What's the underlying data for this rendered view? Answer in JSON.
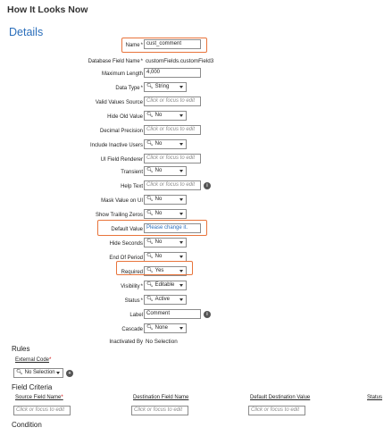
{
  "page": {
    "heading": "How It Looks Now",
    "section_title": "Details"
  },
  "fields": [
    {
      "id": "name",
      "label": "Name",
      "req": "*",
      "type": "text",
      "value": "cust_comment",
      "style": "val"
    },
    {
      "id": "db-field-name",
      "label": "Database Field Name",
      "req": "*",
      "type": "plain",
      "value": "customFields.customField3"
    },
    {
      "id": "max-length",
      "label": "Maximum Length",
      "req": "",
      "type": "text",
      "value": "4,000",
      "style": "val"
    },
    {
      "id": "data-type",
      "label": "Data Type",
      "req": "*",
      "type": "select",
      "value": "String"
    },
    {
      "id": "valid-values-source",
      "label": "Valid Values Source",
      "req": "",
      "type": "text",
      "value": "Click or focus to edit",
      "style": "ph"
    },
    {
      "id": "hide-old-value",
      "label": "Hide Old Value",
      "req": "",
      "type": "select",
      "value": "No"
    },
    {
      "id": "decimal-precision",
      "label": "Decimal Precision",
      "req": "",
      "type": "text",
      "value": "Click or focus to edit",
      "style": "ph"
    },
    {
      "id": "include-inactive-users",
      "label": "Include Inactive Users",
      "req": "",
      "type": "select",
      "value": "No"
    },
    {
      "id": "ui-field-renderer",
      "label": "UI Field Renderer",
      "req": "",
      "type": "text",
      "value": "Click or focus to edit",
      "style": "ph"
    },
    {
      "id": "transient",
      "label": "Transient",
      "req": "",
      "type": "select",
      "value": "No"
    },
    {
      "id": "help-text",
      "label": "Help Text",
      "req": "",
      "type": "text",
      "value": "Click or focus to edit",
      "style": "ph",
      "info": true
    },
    {
      "id": "mask-value-on-ui",
      "label": "Mask Value on UI",
      "req": "",
      "type": "select",
      "value": "No"
    },
    {
      "id": "show-trailing-zeros",
      "label": "Show Trailing Zeros",
      "req": "",
      "type": "select",
      "value": "No"
    },
    {
      "id": "default-value",
      "label": "Default Value",
      "req": "",
      "type": "text",
      "value": "Please change it.",
      "style": "blue"
    },
    {
      "id": "hide-seconds",
      "label": "Hide Seconds",
      "req": "",
      "type": "select",
      "value": "No"
    },
    {
      "id": "end-of-period",
      "label": "End Of Period",
      "req": "",
      "type": "select",
      "value": "No"
    },
    {
      "id": "required",
      "label": "Required",
      "req": "",
      "type": "select",
      "value": "Yes"
    },
    {
      "id": "visibility",
      "label": "Visibility",
      "req": "*",
      "type": "select",
      "value": "Editable"
    },
    {
      "id": "status",
      "label": "Status",
      "req": "*",
      "type": "select",
      "value": "Active"
    },
    {
      "id": "label",
      "label": "Label",
      "req": "",
      "type": "text",
      "value": "Comment",
      "style": "val",
      "info": true
    },
    {
      "id": "cascade",
      "label": "Cascade",
      "req": "",
      "type": "select",
      "value": "None"
    },
    {
      "id": "inactivated-by",
      "label": "Inactivated By",
      "req": "",
      "type": "plain",
      "value": "No Selection"
    }
  ],
  "rules": {
    "title": "Rules",
    "external_code_label": "External Code",
    "external_code_req": "*",
    "external_code_value": "No Selection"
  },
  "field_criteria": {
    "title": "Field Criteria",
    "columns": [
      {
        "label": "Source Field Name",
        "req": "*"
      },
      {
        "label": "Destination Field Name",
        "req": ""
      },
      {
        "label": "Default Destination Value",
        "req": ""
      },
      {
        "label": "Status",
        "req": ""
      }
    ],
    "placeholder": "Click or focus to edit"
  },
  "condition": {
    "title": "Condition"
  },
  "colors": {
    "accent": "#2a6ebb",
    "highlight": "#e8743b",
    "required": "#cc0000"
  }
}
